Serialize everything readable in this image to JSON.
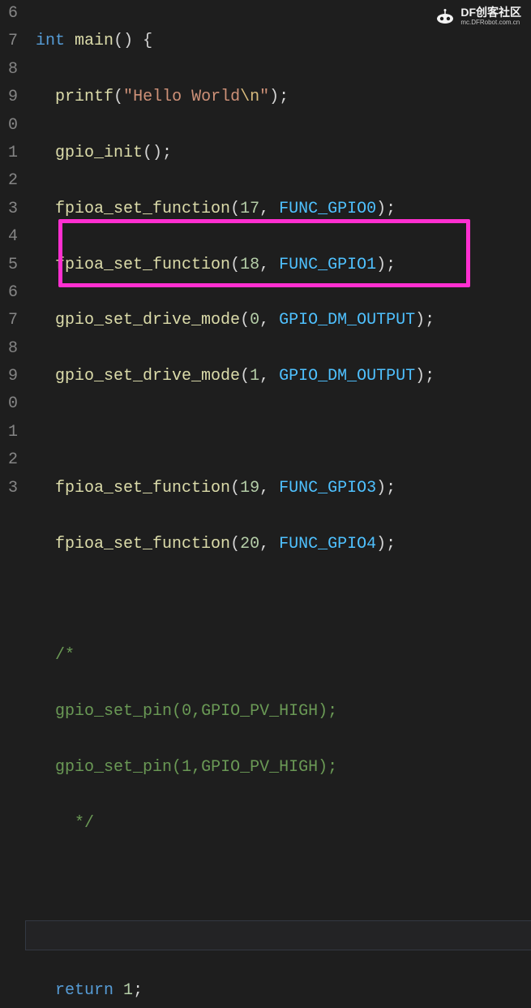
{
  "watermark": {
    "main": "DF创客社区",
    "sub": "mc.DFRobot.com.cn"
  },
  "line_numbers": [
    "6",
    "7",
    "8",
    "9",
    "0",
    "1",
    "2",
    "3",
    "4",
    "5",
    "6",
    "7",
    "8",
    "9",
    "0",
    "1",
    "2",
    "3"
  ],
  "tokens": {
    "int": "int",
    "main": "main",
    "brace_open": "{",
    "printf": "printf",
    "str_open": "\"",
    "str_body": "Hello World",
    "str_esc": "\\n",
    "gpio_init": "gpio_init",
    "fpioa_set_function": "fpioa_set_function",
    "gpio_set_drive_mode": "gpio_set_drive_mode",
    "gpio_set_pin": "gpio_set_pin",
    "n17": "17",
    "n18": "18",
    "n19": "19",
    "n20": "20",
    "n0": "0",
    "n1": "1",
    "FUNC_GPIO0": "FUNC_GPIO0",
    "FUNC_GPIO1": "FUNC_GPIO1",
    "FUNC_GPIO3": "FUNC_GPIO3",
    "FUNC_GPIO4": "FUNC_GPIO4",
    "GPIO_DM_OUTPUT": "GPIO_DM_OUTPUT",
    "GPIO_PV_HIGH": "GPIO_PV_HIGH",
    "cmt_open": "/*",
    "cmt_close": "*/",
    "return": "return",
    "ret_val": "1"
  }
}
